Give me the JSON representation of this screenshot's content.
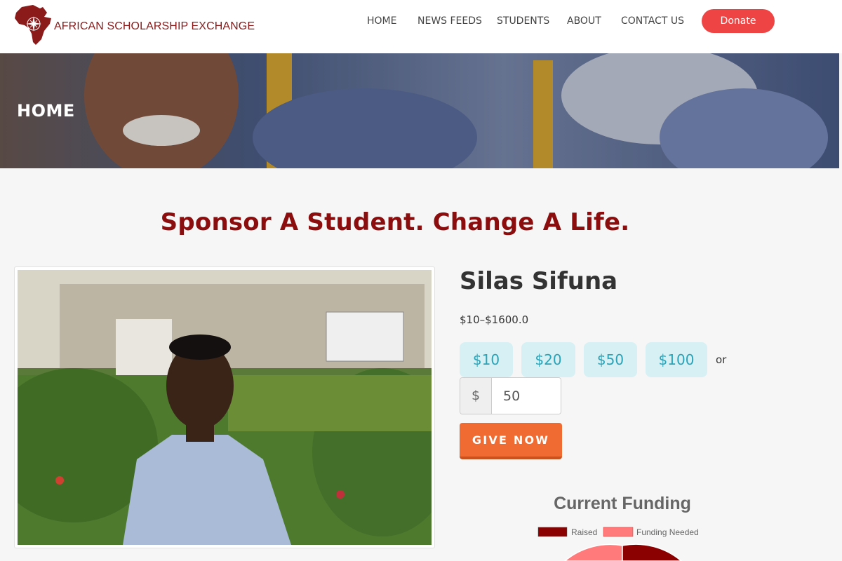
{
  "header": {
    "logo_text": "AFRICAN SCHOLARSHIP EXCHANGE",
    "nav": [
      "HOME",
      "NEWS FEEDS",
      "STUDENTS",
      "ABOUT",
      "CONTACT US"
    ],
    "donate_label": "Donate"
  },
  "hero": {
    "title": "HOME"
  },
  "tagline": "Sponsor A Student. Change A Life.",
  "product": {
    "name": "Silas Sifuna",
    "price_range": "$10–$1600.0",
    "amounts": [
      "$10",
      "$20",
      "$50",
      "$100"
    ],
    "or_label": "or",
    "currency_symbol": "$",
    "custom_amount_value": "50",
    "give_label": "GIVE NOW"
  },
  "chart_data": {
    "type": "pie",
    "title": "Current Funding",
    "legend": [
      "Raised",
      "Funding Needed"
    ],
    "legend_position": "top",
    "colors": {
      "Raised": "#8b0000",
      "Funding Needed": "#ff7a7a"
    }
  },
  "colors": {
    "brand": "#8b1a1a",
    "donate": "#ef4444",
    "give": "#ef6b32",
    "amount_bg": "#d6f0f3",
    "amount_text": "#2aa3b8"
  }
}
